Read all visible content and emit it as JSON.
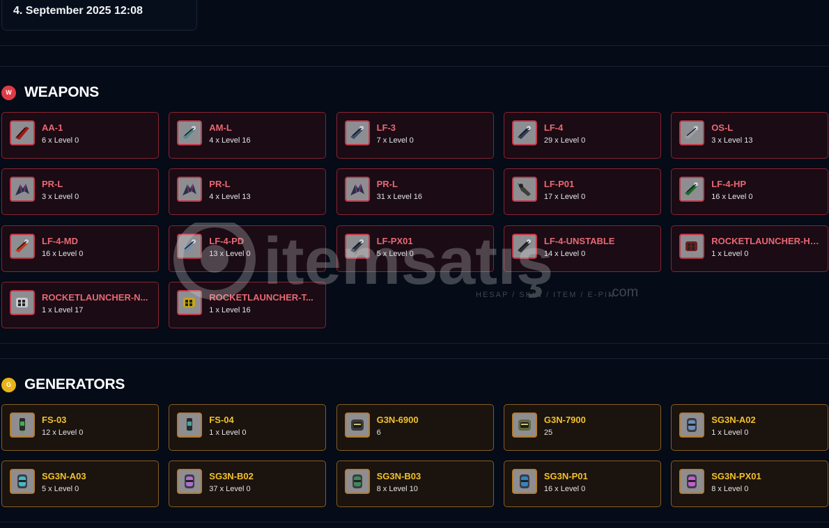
{
  "header": {
    "date": "4. September 2025 12:08"
  },
  "watermark": {
    "brand": "itemsatış",
    "domain": ".com",
    "tagline": "HESAP / SKIN / ITEM / E-PIN"
  },
  "weapons": {
    "badge": "W",
    "title": "WEAPONS",
    "color": "#e03a45",
    "items": [
      {
        "name": "AA-1",
        "qty": "6 x Level 0",
        "icon": "red-blade-icon",
        "tint": "#9c1a1a"
      },
      {
        "name": "AM-L",
        "qty": "4 x Level 16",
        "icon": "laser-cannon-icon",
        "tint": "#4f8a8a"
      },
      {
        "name": "LF-3",
        "qty": "7 x Level 0",
        "icon": "laser-cannon-icon",
        "tint": "#3a4f6a"
      },
      {
        "name": "LF-4",
        "qty": "29 x Level 0",
        "icon": "laser-cannon-icon",
        "tint": "#2e3c57"
      },
      {
        "name": "OS-L",
        "qty": "3 x Level 13",
        "icon": "laser-cannon-icon",
        "tint": "#9aa0a8"
      },
      {
        "name": "PR-L",
        "qty": "3 x Level 0",
        "icon": "claw-cannon-icon",
        "tint": "#2a2f4a"
      },
      {
        "name": "PR-L",
        "qty": "4 x Level 13",
        "icon": "claw-cannon-icon",
        "tint": "#2a2f4a"
      },
      {
        "name": "PR-L",
        "qty": "31 x Level 16",
        "icon": "claw-cannon-icon",
        "tint": "#2a2f4a"
      },
      {
        "name": "LF-P01",
        "qty": "17 x Level 0",
        "icon": "beast-cannon-icon",
        "tint": "#3b4136"
      },
      {
        "name": "LF-4-HP",
        "qty": "16 x Level 0",
        "icon": "laser-cannon-icon",
        "tint": "#1f6b2a"
      },
      {
        "name": "LF-4-MD",
        "qty": "16 x Level 0",
        "icon": "laser-cannon-icon",
        "tint": "#c0391b"
      },
      {
        "name": "LF-4-PD",
        "qty": "13 x Level 0",
        "icon": "laser-cannon-icon",
        "tint": "#6d8fb0"
      },
      {
        "name": "LF-PX01",
        "qty": "5 x Level 0",
        "icon": "laser-cannon-icon",
        "tint": "#333a44"
      },
      {
        "name": "LF-4-UNSTABLE",
        "qty": "14 x Level 0",
        "icon": "laser-cannon-icon",
        "tint": "#2c2f33"
      },
      {
        "name": "ROCKETLAUNCHER-HONOR",
        "qty": "1 x Level 0",
        "icon": "rocket-launcher-icon",
        "tint": "#6b2020"
      },
      {
        "name": "ROCKETLAUNCHER-N...",
        "qty": "1 x Level 17",
        "icon": "rocket-launcher-icon",
        "tint": "#c9ccd1"
      },
      {
        "name": "ROCKETLAUNCHER-T...",
        "qty": "1 x Level 16",
        "icon": "rocket-launcher-icon",
        "tint": "#c4a51c"
      }
    ]
  },
  "generators": {
    "badge": "G",
    "title": "GENERATORS",
    "color": "#e8b416",
    "items": [
      {
        "name": "FS-03",
        "qty": "12 x Level 0",
        "icon": "thruster-icon",
        "tint": "#3cb34a"
      },
      {
        "name": "FS-04",
        "qty": "1 x Level 0",
        "icon": "thruster-icon",
        "tint": "#4aa5a0"
      },
      {
        "name": "G3N-6900",
        "qty": "6",
        "icon": "engine-block-icon",
        "tint": "#3b3b3b"
      },
      {
        "name": "G3N-7900",
        "qty": "25",
        "icon": "engine-block-icon",
        "tint": "#5e6b3a"
      },
      {
        "name": "SG3N-A02",
        "qty": "1 x Level 0",
        "icon": "shield-generator-icon",
        "tint": "#6d8fb8"
      },
      {
        "name": "SG3N-A03",
        "qty": "5 x Level 0",
        "icon": "shield-generator-icon",
        "tint": "#41b9c4"
      },
      {
        "name": "SG3N-B02",
        "qty": "37 x Level 0",
        "icon": "shield-generator-icon",
        "tint": "#b06fcf"
      },
      {
        "name": "SG3N-B03",
        "qty": "8 x Level 10",
        "icon": "shield-generator-icon",
        "tint": "#3d8a5a"
      },
      {
        "name": "SG3N-P01",
        "qty": "16 x Level 0",
        "icon": "shield-generator-icon",
        "tint": "#2f86c4"
      },
      {
        "name": "SG3N-PX01",
        "qty": "8 x Level 0",
        "icon": "shield-generator-icon",
        "tint": "#c75bd0"
      }
    ]
  }
}
